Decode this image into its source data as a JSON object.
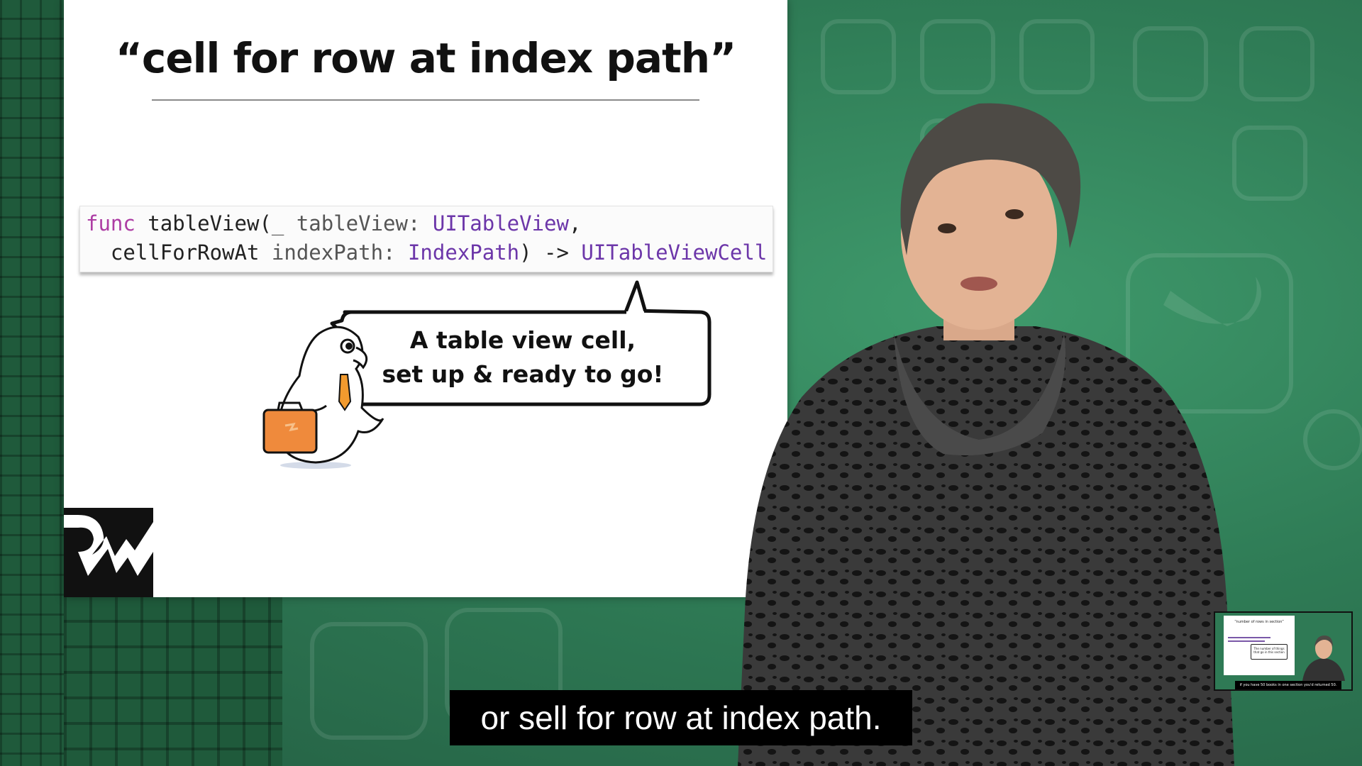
{
  "slide": {
    "title": "“cell for row at index path”",
    "code": {
      "line1": {
        "keyword": "func",
        "name": " tableView(",
        "underscore": "_",
        "param": " tableView: ",
        "type": "UITableView",
        "comma": ","
      },
      "line2": {
        "label": "  cellForRowAt",
        "param": " indexPath: ",
        "type": "IndexPath",
        "arrow": ") -> ",
        "return_type": "UITableViewCell"
      }
    },
    "callout": {
      "line1": "A table view cell,",
      "line2": "set up & ready to go!"
    }
  },
  "caption": "or sell for row at index path.",
  "thumbnail": {
    "title": "“number of rows in section”",
    "bubble": "The number of things that go in this section",
    "caption": "if you have 50 books in one section you'd returned 50."
  },
  "colors": {
    "keyword": "#ad3da4",
    "type": "#6c36a9",
    "background_green": "#2f7a55",
    "briefcase": "#ef8a3c"
  },
  "icons": {
    "mascot": "bird-mascot-with-briefcase",
    "logo": "rw-logo",
    "background": "swift-icons-pattern"
  }
}
